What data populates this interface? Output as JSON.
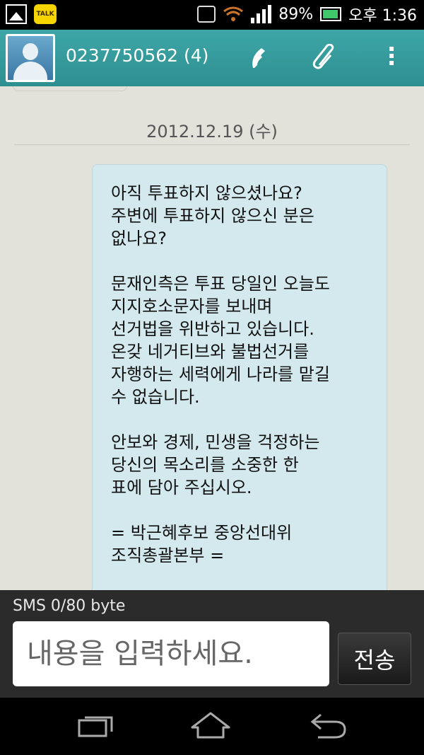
{
  "status_bar": {
    "talk_label": "TALK",
    "battery_percent": "89%",
    "time": "오후 1:36"
  },
  "header": {
    "contact_title": "0237750562 (4)",
    "icons": [
      "avatar",
      "phone-icon",
      "paperclip-icon",
      "overflow-menu-icon"
    ]
  },
  "conversation": {
    "date": "2012.12.19 (수)",
    "messages": [
      {
        "text": "아직 투표하지 않으셨나요?\n주변에 투표하지 않으신 분은\n없나요?\n\n문재인측은 투표 당일인 오늘도\n지지호소문자를 보내며\n선거법을 위반하고 있습니다.\n온갖 네거티브와 불법선거를\n자행하는 세력에게 나라를 맡길\n수 없습니다.\n\n안보와 경제, 민생을 걱정하는\n당신의 목소리를 소중한 한\n표에 담아 주십시오.\n\n= 박근혜후보 중앙선대위\n조직총괄본부 ="
      }
    ]
  },
  "compose": {
    "counter": "SMS  0/80 byte",
    "placeholder": "내용을 입력하세요.",
    "send_label": "전송"
  },
  "colors": {
    "action_bar": "#3ea6a7",
    "bubble": "#d3e9ee",
    "conversation_bg": "#e2e2da"
  }
}
